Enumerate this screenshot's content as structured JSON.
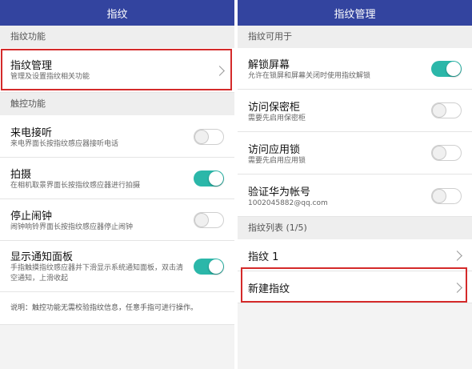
{
  "left": {
    "title": "指纹",
    "section_fingerprint": "指纹功能",
    "manage": {
      "title": "指纹管理",
      "sub": "管理及设置指纹相关功能"
    },
    "section_touch": "触控功能",
    "items": [
      {
        "title": "来电接听",
        "sub": "来电界面长按指纹感应器接听电话",
        "state": "off"
      },
      {
        "title": "拍摄",
        "sub": "在相机取景界面长按指纹感应器进行拍摄",
        "state": "on"
      },
      {
        "title": "停止闹钟",
        "sub": "闹钟响铃界面长按指纹感应器停止闹钟",
        "state": "off"
      },
      {
        "title": "显示通知面板",
        "sub_line1": "手指触摸指纹感应器并下滑显示系统通知面板，双击清",
        "sub_line2": "空通知，上滑收起",
        "state": "on"
      }
    ],
    "note": "说明：触控功能无需校验指纹信息，任意手指可进行操作。"
  },
  "right": {
    "title": "指纹管理",
    "section_usable": "指纹可用于",
    "items": [
      {
        "title": "解锁屏幕",
        "sub": "允许在锁屏和屏幕关闭时使用指纹解锁",
        "state": "on"
      },
      {
        "title": "访问保密柜",
        "sub": "需要先启用保密柜",
        "state": "off"
      },
      {
        "title": "访问应用锁",
        "sub": "需要先启用应用锁",
        "state": "off"
      },
      {
        "title": "验证华为帐号",
        "sub": "1002045882@qq.com",
        "state": "off"
      }
    ],
    "section_list": "指纹列表 (1/5)",
    "fingerprint1": "指纹 1",
    "new_fingerprint": "新建指纹"
  },
  "colors": {
    "titlebar": "#33449f",
    "toggle_on": "#2bb7a9",
    "highlight": "#d42a2a"
  }
}
